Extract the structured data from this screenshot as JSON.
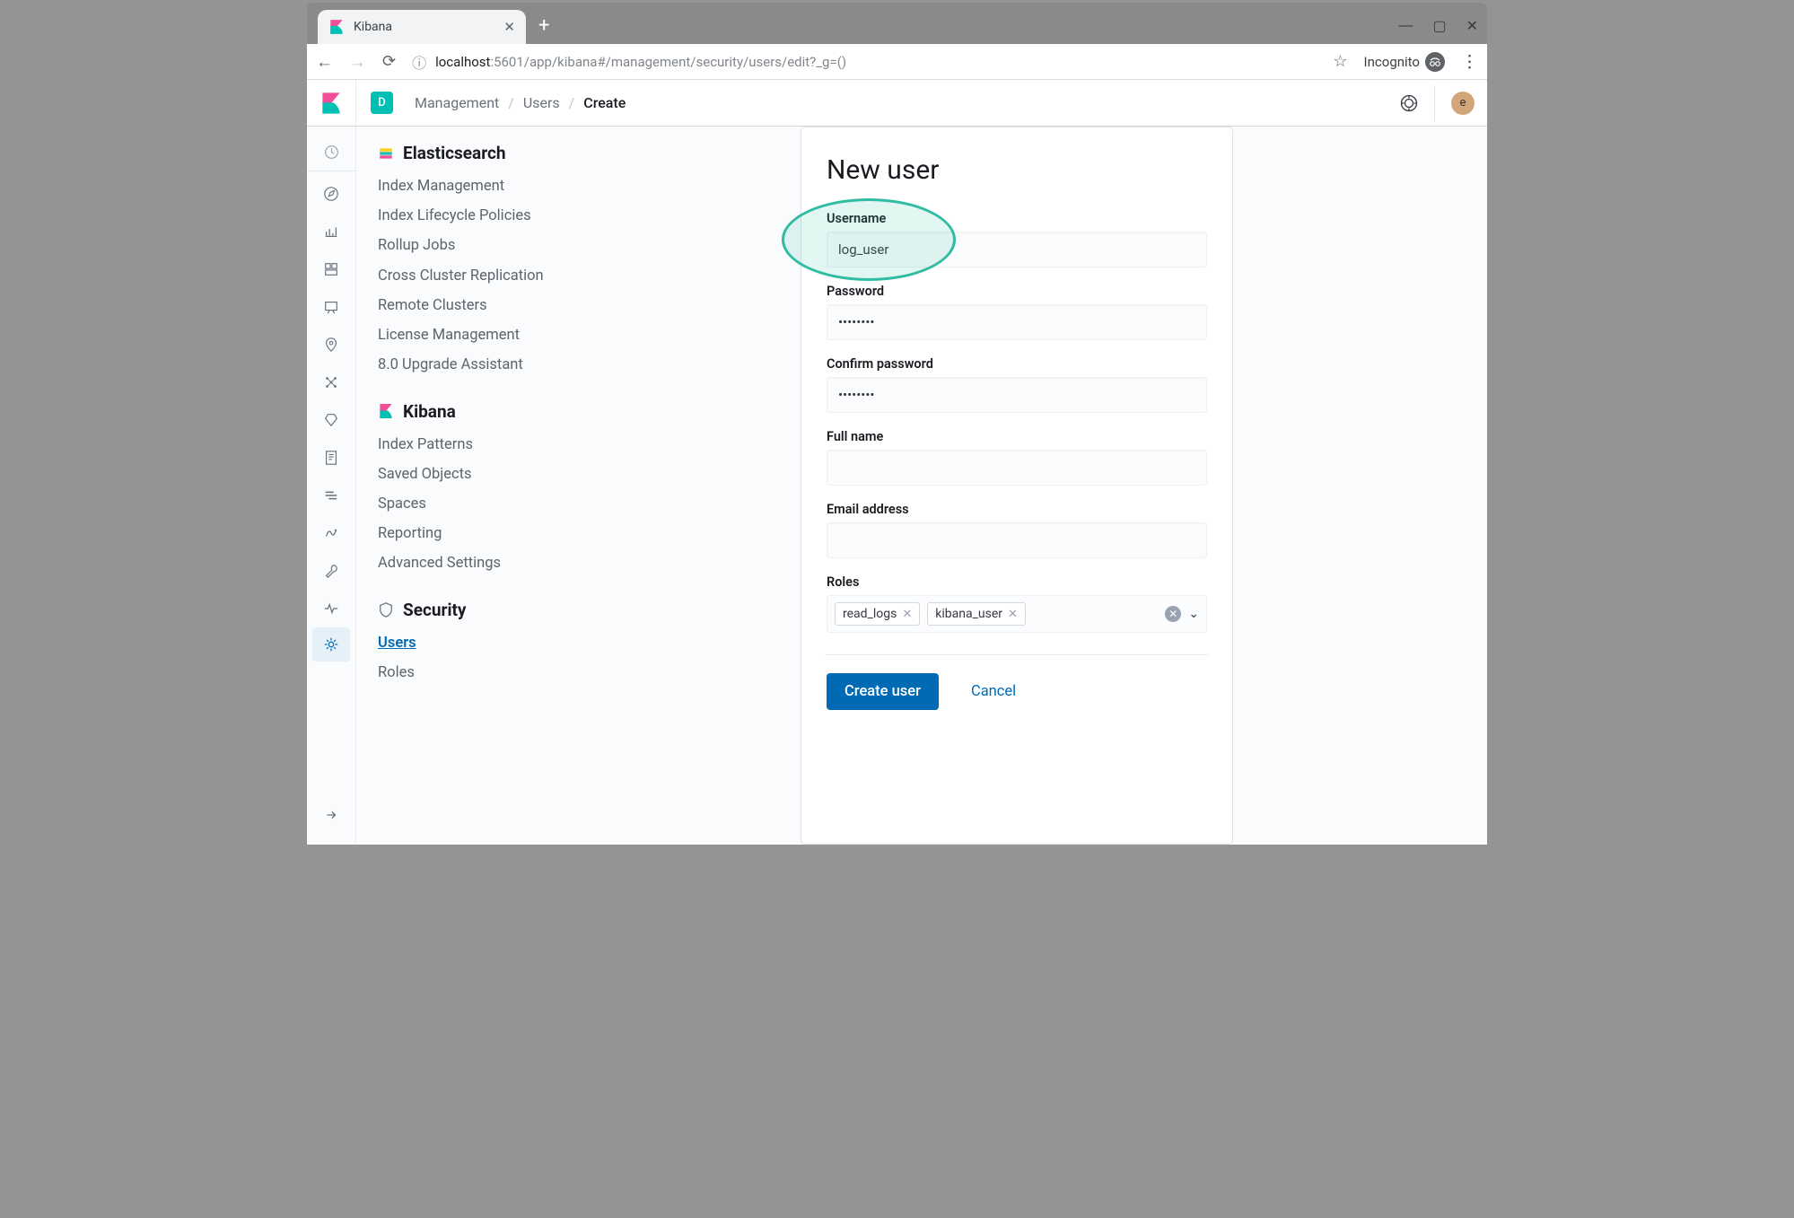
{
  "browser": {
    "tab_title": "Kibana",
    "url_host": "localhost",
    "url_path": ":5601/app/kibana#/management/security/users/edit?_g=()",
    "incognito_label": "Incognito"
  },
  "topbar": {
    "space_letter": "D",
    "avatar_letter": "e",
    "breadcrumbs": [
      "Management",
      "Users",
      "Create"
    ]
  },
  "sidebar": {
    "sections": [
      {
        "title": "Elasticsearch",
        "items": [
          "Index Management",
          "Index Lifecycle Policies",
          "Rollup Jobs",
          "Cross Cluster Replication",
          "Remote Clusters",
          "License Management",
          "8.0 Upgrade Assistant"
        ]
      },
      {
        "title": "Kibana",
        "items": [
          "Index Patterns",
          "Saved Objects",
          "Spaces",
          "Reporting",
          "Advanced Settings"
        ]
      },
      {
        "title": "Security",
        "items": [
          "Users",
          "Roles"
        ],
        "active": "Users"
      }
    ]
  },
  "form": {
    "title": "New user",
    "username_label": "Username",
    "username_value": "log_user",
    "password_label": "Password",
    "password_value": "••••••••",
    "confirm_label": "Confirm password",
    "confirm_value": "••••••••",
    "fullname_label": "Full name",
    "fullname_value": "",
    "email_label": "Email address",
    "email_value": "",
    "roles_label": "Roles",
    "roles": [
      "read_logs",
      "kibana_user"
    ],
    "submit_label": "Create user",
    "cancel_label": "Cancel"
  }
}
